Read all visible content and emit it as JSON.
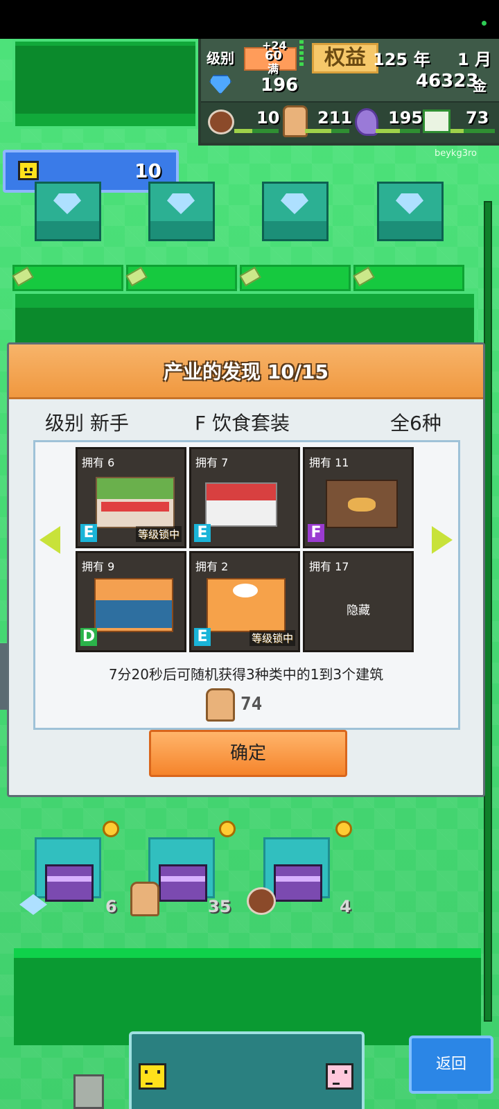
{
  "hud": {
    "level_label": "级别",
    "level_plus": "+24",
    "level_value": "60",
    "level_full": "满",
    "rights_label": "权益",
    "year": "125 年",
    "month": "1 月",
    "gems": "196",
    "gold": "46323",
    "gold_unit": "金",
    "food": "10",
    "bags": "211",
    "music": "195",
    "books": "73"
  },
  "watermark": "beykg3ro",
  "player_level": "10",
  "dialog": {
    "title": "产业的发现 10/15",
    "level_text": "级别 新手",
    "category_text": "F  饮食套装",
    "total_text": "全6种",
    "items": [
      {
        "own": "拥有 6",
        "grade": "E",
        "lock": "等级锁中",
        "color": "#1ab4d8"
      },
      {
        "own": "拥有 7",
        "grade": "E",
        "lock": "",
        "color": "#1ab4d8"
      },
      {
        "own": "拥有 11",
        "grade": "F",
        "lock": "",
        "color": "#9b3bd1"
      },
      {
        "own": "拥有 9",
        "grade": "D",
        "lock": "",
        "color": "#2bb34a"
      },
      {
        "own": "拥有 2",
        "grade": "E",
        "lock": "等级锁中",
        "color": "#1ab4d8"
      },
      {
        "own": "拥有 17",
        "grade": "",
        "lock": "",
        "hidden": "隐藏"
      }
    ],
    "note": "7分20秒后可随机获得3种类中的1到3个建筑",
    "cost": "74",
    "ok_label": "确定"
  },
  "lower": {
    "count_gems": "6",
    "count_bags": "35",
    "count_food": "4"
  },
  "back_label": "返回",
  "colors": {
    "accent_orange": "#f0983f",
    "back_blue": "#2b86e6",
    "bg_green": "#43d26a"
  }
}
